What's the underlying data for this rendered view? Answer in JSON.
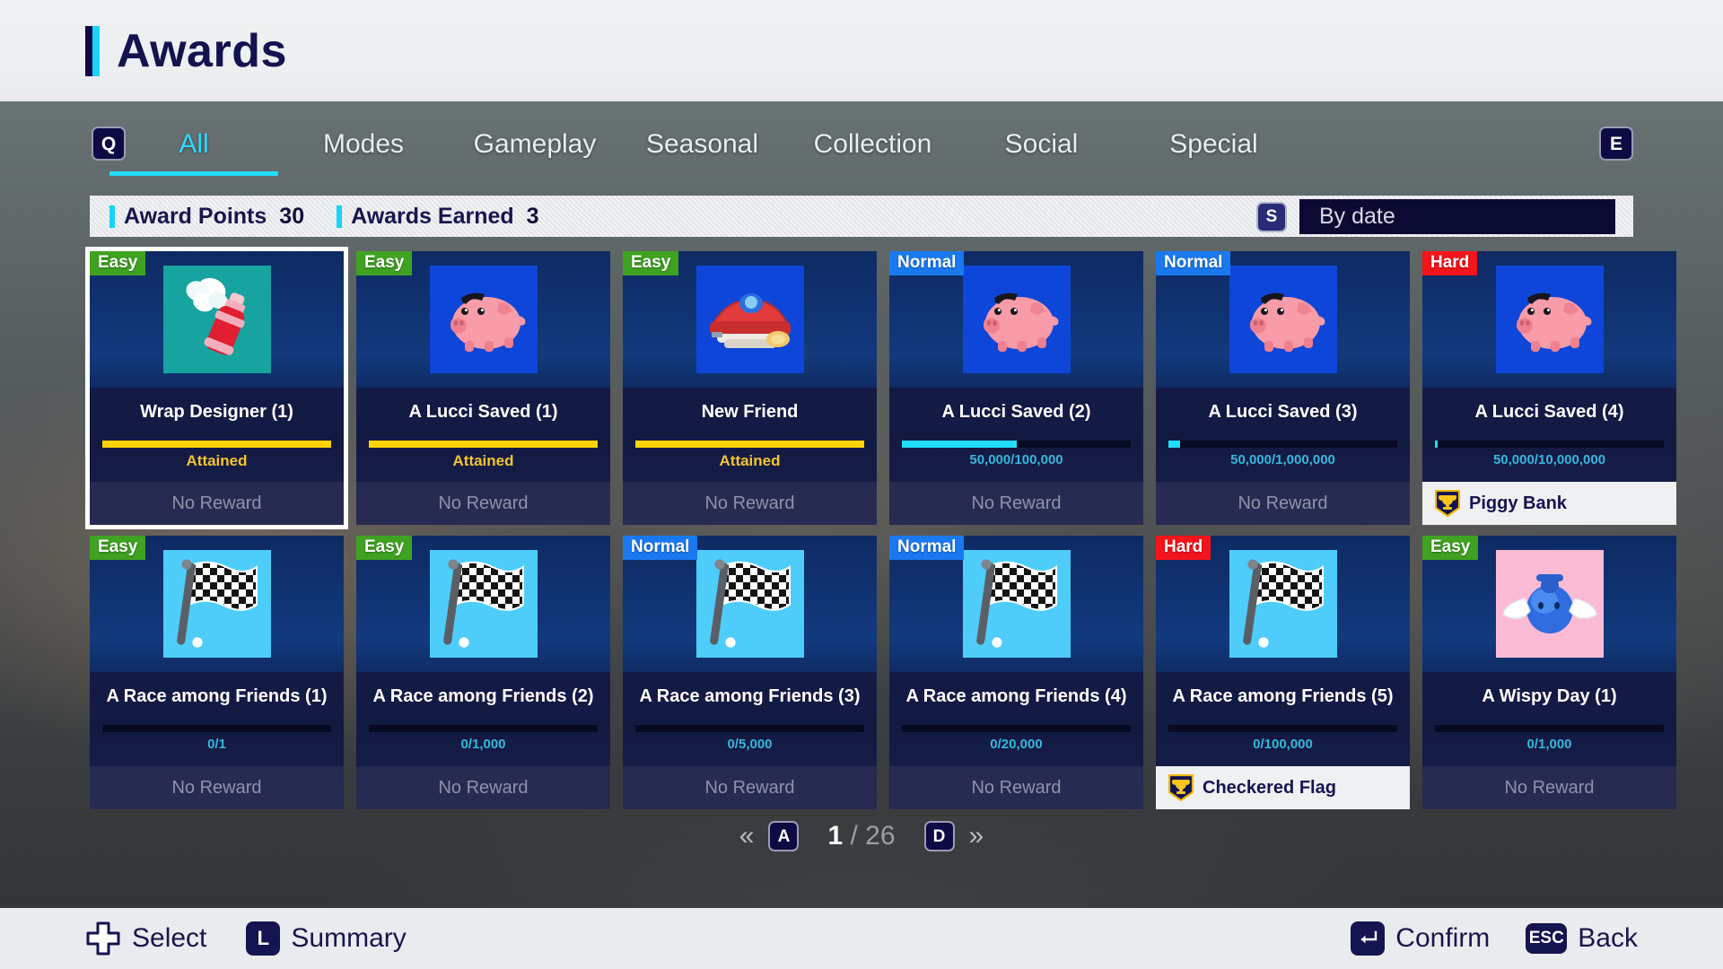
{
  "header": {
    "title": "Awards"
  },
  "tabs": {
    "left_key": "Q",
    "right_key": "E",
    "items": [
      {
        "label": "All",
        "active": true
      },
      {
        "label": "Modes",
        "active": false
      },
      {
        "label": "Gameplay",
        "active": false
      },
      {
        "label": "Seasonal",
        "active": false
      },
      {
        "label": "Collection",
        "active": false
      },
      {
        "label": "Social",
        "active": false
      },
      {
        "label": "Special",
        "active": false
      }
    ]
  },
  "stats": {
    "award_points_label": "Award Points",
    "award_points_value": "30",
    "awards_earned_label": "Awards Earned",
    "awards_earned_value": "3",
    "sort_key": "S",
    "sort_value": "By date"
  },
  "cards": [
    {
      "difficulty": "Easy",
      "icon": "spray-can-icon",
      "icon_bg": "teal",
      "title": "Wrap Designer (1)",
      "progress_text": "Attained",
      "progress_pct": 100,
      "attained": true,
      "reward": "No Reward",
      "has_reward": false,
      "selected": true
    },
    {
      "difficulty": "Easy",
      "icon": "piggy-bank-icon",
      "icon_bg": "blue",
      "title": "A Lucci Saved (1)",
      "progress_text": "Attained",
      "progress_pct": 100,
      "attained": true,
      "reward": "No Reward",
      "has_reward": false,
      "selected": false
    },
    {
      "difficulty": "Easy",
      "icon": "race-car-icon",
      "icon_bg": "blue",
      "title": "New Friend",
      "progress_text": "Attained",
      "progress_pct": 100,
      "attained": true,
      "reward": "No Reward",
      "has_reward": false,
      "selected": false
    },
    {
      "difficulty": "Normal",
      "icon": "piggy-bank-icon",
      "icon_bg": "blue",
      "title": "A Lucci Saved (2)",
      "progress_text": "50,000/100,000",
      "progress_pct": 50,
      "attained": false,
      "reward": "No Reward",
      "has_reward": false,
      "selected": false
    },
    {
      "difficulty": "Normal",
      "icon": "piggy-bank-icon",
      "icon_bg": "blue",
      "title": "A Lucci Saved (3)",
      "progress_text": "50,000/1,000,000",
      "progress_pct": 5,
      "attained": false,
      "reward": "No Reward",
      "has_reward": false,
      "selected": false
    },
    {
      "difficulty": "Hard",
      "icon": "piggy-bank-icon",
      "icon_bg": "blue",
      "title": "A Lucci Saved (4)",
      "progress_text": "50,000/10,000,000",
      "progress_pct": 1,
      "attained": false,
      "reward": "Piggy Bank",
      "has_reward": true,
      "selected": false
    },
    {
      "difficulty": "Easy",
      "icon": "checkered-flag-icon",
      "icon_bg": "sky",
      "title": "A Race among Friends (1)",
      "progress_text": "0/1",
      "progress_pct": 0,
      "attained": false,
      "reward": "No Reward",
      "has_reward": false,
      "selected": false
    },
    {
      "difficulty": "Easy",
      "icon": "checkered-flag-icon",
      "icon_bg": "sky",
      "title": "A Race among Friends (2)",
      "progress_text": "0/1,000",
      "progress_pct": 0,
      "attained": false,
      "reward": "No Reward",
      "has_reward": false,
      "selected": false
    },
    {
      "difficulty": "Normal",
      "icon": "checkered-flag-icon",
      "icon_bg": "sky",
      "title": "A Race among Friends (3)",
      "progress_text": "0/5,000",
      "progress_pct": 0,
      "attained": false,
      "reward": "No Reward",
      "has_reward": false,
      "selected": false
    },
    {
      "difficulty": "Normal",
      "icon": "checkered-flag-icon",
      "icon_bg": "sky",
      "title": "A Race among Friends (4)",
      "progress_text": "0/20,000",
      "progress_pct": 0,
      "attained": false,
      "reward": "No Reward",
      "has_reward": false,
      "selected": false
    },
    {
      "difficulty": "Hard",
      "icon": "checkered-flag-icon",
      "icon_bg": "sky",
      "title": "A Race among Friends (5)",
      "progress_text": "0/100,000",
      "progress_pct": 0,
      "attained": false,
      "reward": "Checkered Flag",
      "has_reward": true,
      "selected": false
    },
    {
      "difficulty": "Easy",
      "icon": "wisp-icon",
      "icon_bg": "pink",
      "title": "A Wispy Day (1)",
      "progress_text": "0/1,000",
      "progress_pct": 0,
      "attained": false,
      "reward": "No Reward",
      "has_reward": false,
      "selected": false
    }
  ],
  "pager": {
    "first_glyph": "«",
    "last_glyph": "»",
    "prev_key": "A",
    "next_key": "D",
    "current": "1",
    "separator": "/",
    "total": "26"
  },
  "actions": {
    "select": {
      "key": "dpad-icon",
      "label": "Select"
    },
    "summary": {
      "key": "L",
      "label": "Summary"
    },
    "confirm": {
      "key": "enter-icon",
      "label": "Confirm"
    },
    "back": {
      "key": "ESC",
      "label": "Back"
    }
  },
  "colors": {
    "accent_cyan": "#20dcff",
    "title_navy": "#131350",
    "easy": "#3fa221",
    "normal": "#1a79f0",
    "hard": "#f4141b",
    "attained_gold": "#ffd400"
  }
}
